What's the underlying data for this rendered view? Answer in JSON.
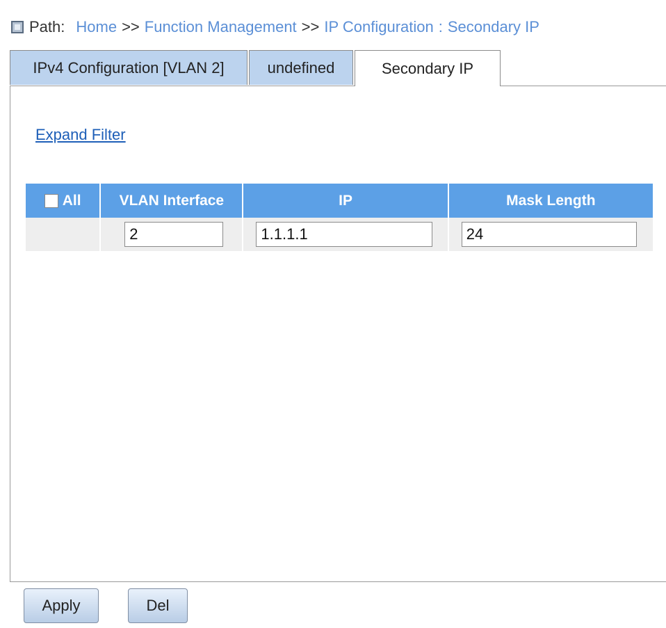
{
  "breadcrumb": {
    "icon": "box-icon",
    "label": "Path:",
    "home": "Home",
    "sep1": ">>",
    "function_management": "Function Management",
    "sep2": ">>",
    "ip_configuration": "IP Configuration",
    "colon": ":",
    "secondary_ip": "Secondary IP"
  },
  "tabs": [
    {
      "label": "IPv4 Configuration [VLAN 2]",
      "active": false
    },
    {
      "label": "undefined",
      "active": false
    },
    {
      "label": "Secondary IP",
      "active": true
    }
  ],
  "filter": {
    "expand_label": "Expand Filter"
  },
  "table": {
    "headers": {
      "all": "All",
      "vlan_interface": "VLAN Interface",
      "ip": "IP",
      "mask_length": "Mask Length"
    },
    "rows": [
      {
        "checked": false,
        "vlan_interface": "2",
        "ip": "1.1.1.1",
        "mask_length": "24"
      }
    ]
  },
  "buttons": {
    "apply": "Apply",
    "del": "Del"
  },
  "colors": {
    "header_bg": "#5ca0e6",
    "tab_inactive_bg": "#bcd3ee",
    "link": "#5b8fd6"
  }
}
